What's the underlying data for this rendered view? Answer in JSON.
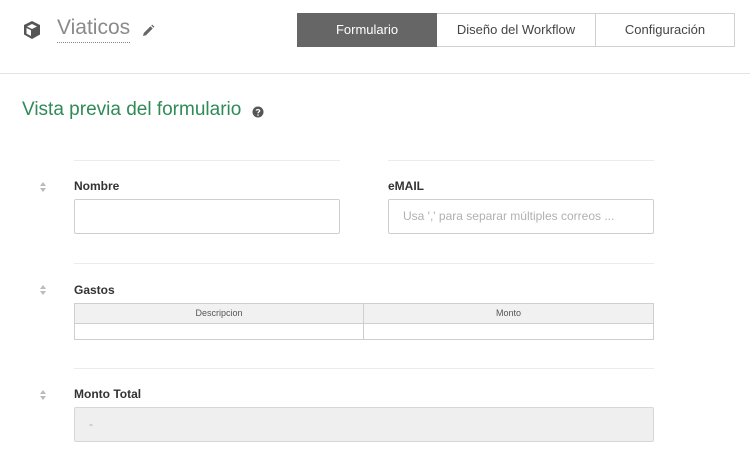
{
  "header": {
    "app_icon": "cube-icon",
    "title": "Viaticos",
    "edit_icon": "pencil-icon",
    "tabs": [
      {
        "label": "Formulario",
        "active": true
      },
      {
        "label": "Diseño del Workflow",
        "active": false
      },
      {
        "label": "Configuración",
        "active": false
      }
    ]
  },
  "preview": {
    "title": "Vista previa del formulario",
    "help_icon": "question-circle-icon"
  },
  "form": {
    "nombre": {
      "label": "Nombre",
      "value": ""
    },
    "email": {
      "label": "eMAIL",
      "placeholder": "Usa ',' para separar múltiples correos ..."
    },
    "gastos": {
      "label": "Gastos",
      "columns": [
        "Descripcion",
        "Monto"
      ]
    },
    "monto_total": {
      "label": "Monto Total",
      "value": "-"
    }
  },
  "colors": {
    "section_title": "#2e8b57",
    "active_tab_bg": "#666666",
    "readonly_bg": "#efefef"
  }
}
